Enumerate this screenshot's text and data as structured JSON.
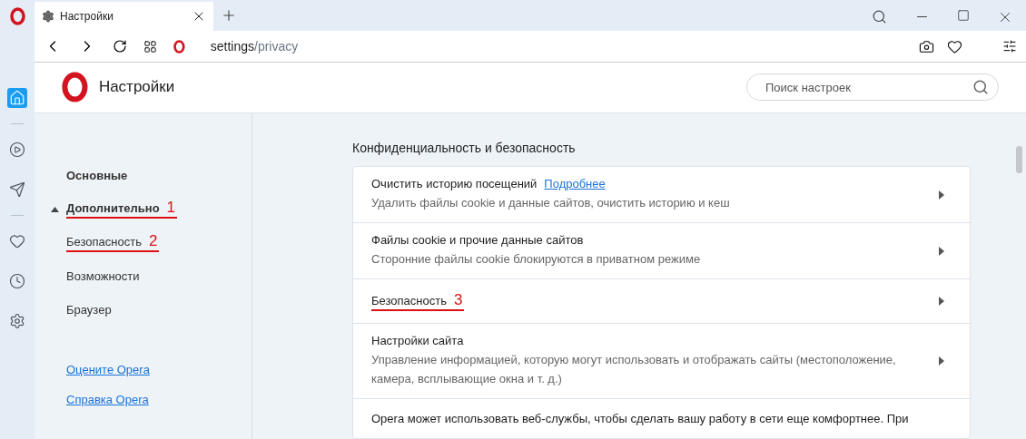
{
  "sidebar": {
    "items": [
      {
        "kind": "home",
        "selected": true
      },
      {
        "kind": "divider"
      },
      {
        "kind": "player",
        "selected": false
      },
      {
        "kind": "send",
        "selected": false
      },
      {
        "kind": "divider"
      },
      {
        "kind": "heart",
        "selected": false
      },
      {
        "kind": "history",
        "selected": false
      },
      {
        "kind": "settings",
        "selected": false
      }
    ]
  },
  "tabs": [
    {
      "title": "Настройки",
      "selected": true
    }
  ],
  "address": {
    "host": "settings",
    "path": "/privacy"
  },
  "header": {
    "title": "Настройки",
    "search": {
      "placeholder": "Поиск настроек"
    }
  },
  "nav": {
    "items": [
      {
        "label": "Основные",
        "kind": "section"
      },
      {
        "label": "Дополнительно",
        "kind": "section",
        "expanded": true,
        "annotation": "1"
      },
      {
        "label": "Безопасность",
        "kind": "item",
        "annotation": "2"
      },
      {
        "label": "Возможности",
        "kind": "item"
      },
      {
        "label": "Браузер",
        "kind": "item"
      }
    ],
    "links": [
      "Оцените Opera",
      "Справка Opera"
    ]
  },
  "section": {
    "title": "Конфиденциальность и безопасность",
    "rows": [
      {
        "title": "Очистить историю посещений",
        "link": "Подробнее",
        "subtitle": "Удалить файлы cookie и данные сайтов, очистить историю и кеш"
      },
      {
        "title": "Файлы cookie и прочие данные сайтов",
        "subtitle": "Сторонние файлы cookie блокируются в приватном режиме"
      },
      {
        "title": "Безопасность",
        "annotation": "3"
      },
      {
        "title": "Настройки сайта",
        "subtitle": "Управление информацией, которую могут использовать и отображать сайты (местоположение, камера, всплывающие окна и т. д.)"
      }
    ],
    "note": "Opera может использовать веб-службы, чтобы сделать вашу работу в сети еще комфортнее. При"
  }
}
